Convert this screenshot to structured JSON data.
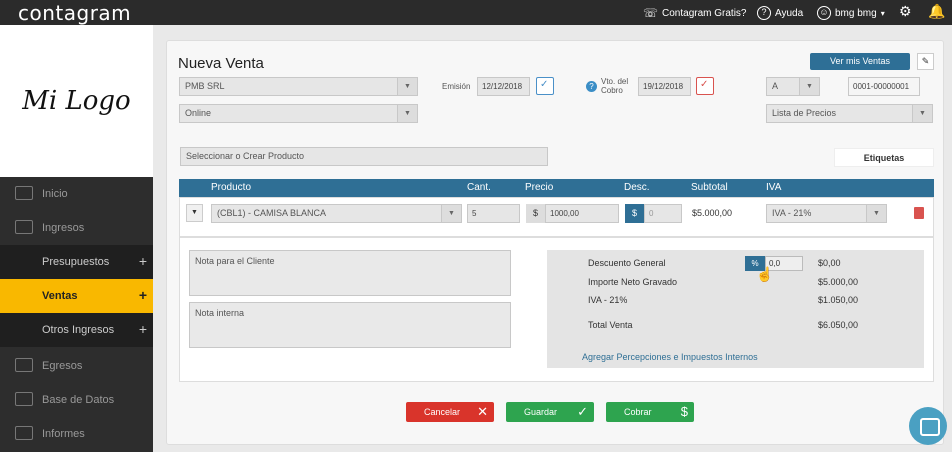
{
  "topbar": {
    "brand": "contagram",
    "free": "Contagram Gratis?",
    "help": "Ayuda",
    "user": "bmg bmg",
    "user_caret": "▾"
  },
  "sidebar": {
    "logo": "Mi Logo",
    "items": [
      {
        "label": "Inicio"
      },
      {
        "label": "Ingresos"
      },
      {
        "label": "Presupuestos",
        "plus": "+"
      },
      {
        "label": "Ventas",
        "plus": "+"
      },
      {
        "label": "Otros Ingresos",
        "plus": "+"
      },
      {
        "label": "Egresos"
      },
      {
        "label": "Base de Datos"
      },
      {
        "label": "Informes"
      }
    ]
  },
  "form": {
    "title": "Nueva Venta",
    "btn_ver": "Ver mis Ventas",
    "btn_edit": "✎",
    "client": "PMB SRL",
    "channel": "Online",
    "emision_label": "Emisión",
    "emision_value": "12/12/2018",
    "vto_label_1": "Vto. del",
    "vto_label_2": "Cobro",
    "vto_value": "19/12/2018",
    "qmark": "?",
    "tipo": "A",
    "numero": "0001-00000001",
    "lista": "Lista de Precios",
    "producto_placeholder": "Seleccionar o Crear Producto",
    "etiquetas": "Etiquetas"
  },
  "table": {
    "headers": [
      "Producto",
      "Cant.",
      "Precio",
      "Desc.",
      "Subtotal",
      "IVA"
    ],
    "row": {
      "product": "(CBL1) - CAMISA BLANCA",
      "qty": "5",
      "price_sign": "$",
      "price": "1000,00",
      "desc_sign": "$",
      "desc": "0",
      "subtotal": "$5.000,00",
      "iva": "IVA - 21%"
    }
  },
  "notes": {
    "client_placeholder": "Nota para el Cliente",
    "internal_placeholder": "Nota interna"
  },
  "summary": {
    "desc_label": "Descuento General",
    "pct_sign": "%",
    "pct_value": "0,0",
    "desc_value": "$0,00",
    "neto_label": "Importe Neto Gravado",
    "neto_value": "$5.000,00",
    "iva_label": "IVA - 21%",
    "iva_value": "$1.050,00",
    "total_label": "Total Venta",
    "total_value": "$6.050,00",
    "link": "Agregar Percepciones e Impuestos Internos"
  },
  "actions": {
    "cancel": "Cancelar",
    "save": "Guardar",
    "charge": "Cobrar",
    "cancel_icon": "✕",
    "save_icon": "✓",
    "charge_icon": "$"
  },
  "colors": {
    "accent": "#2f6f95",
    "active_nav": "#f9b800",
    "cancel": "#d9342b",
    "save": "#2ea44f",
    "charge": "#2ea44f"
  }
}
